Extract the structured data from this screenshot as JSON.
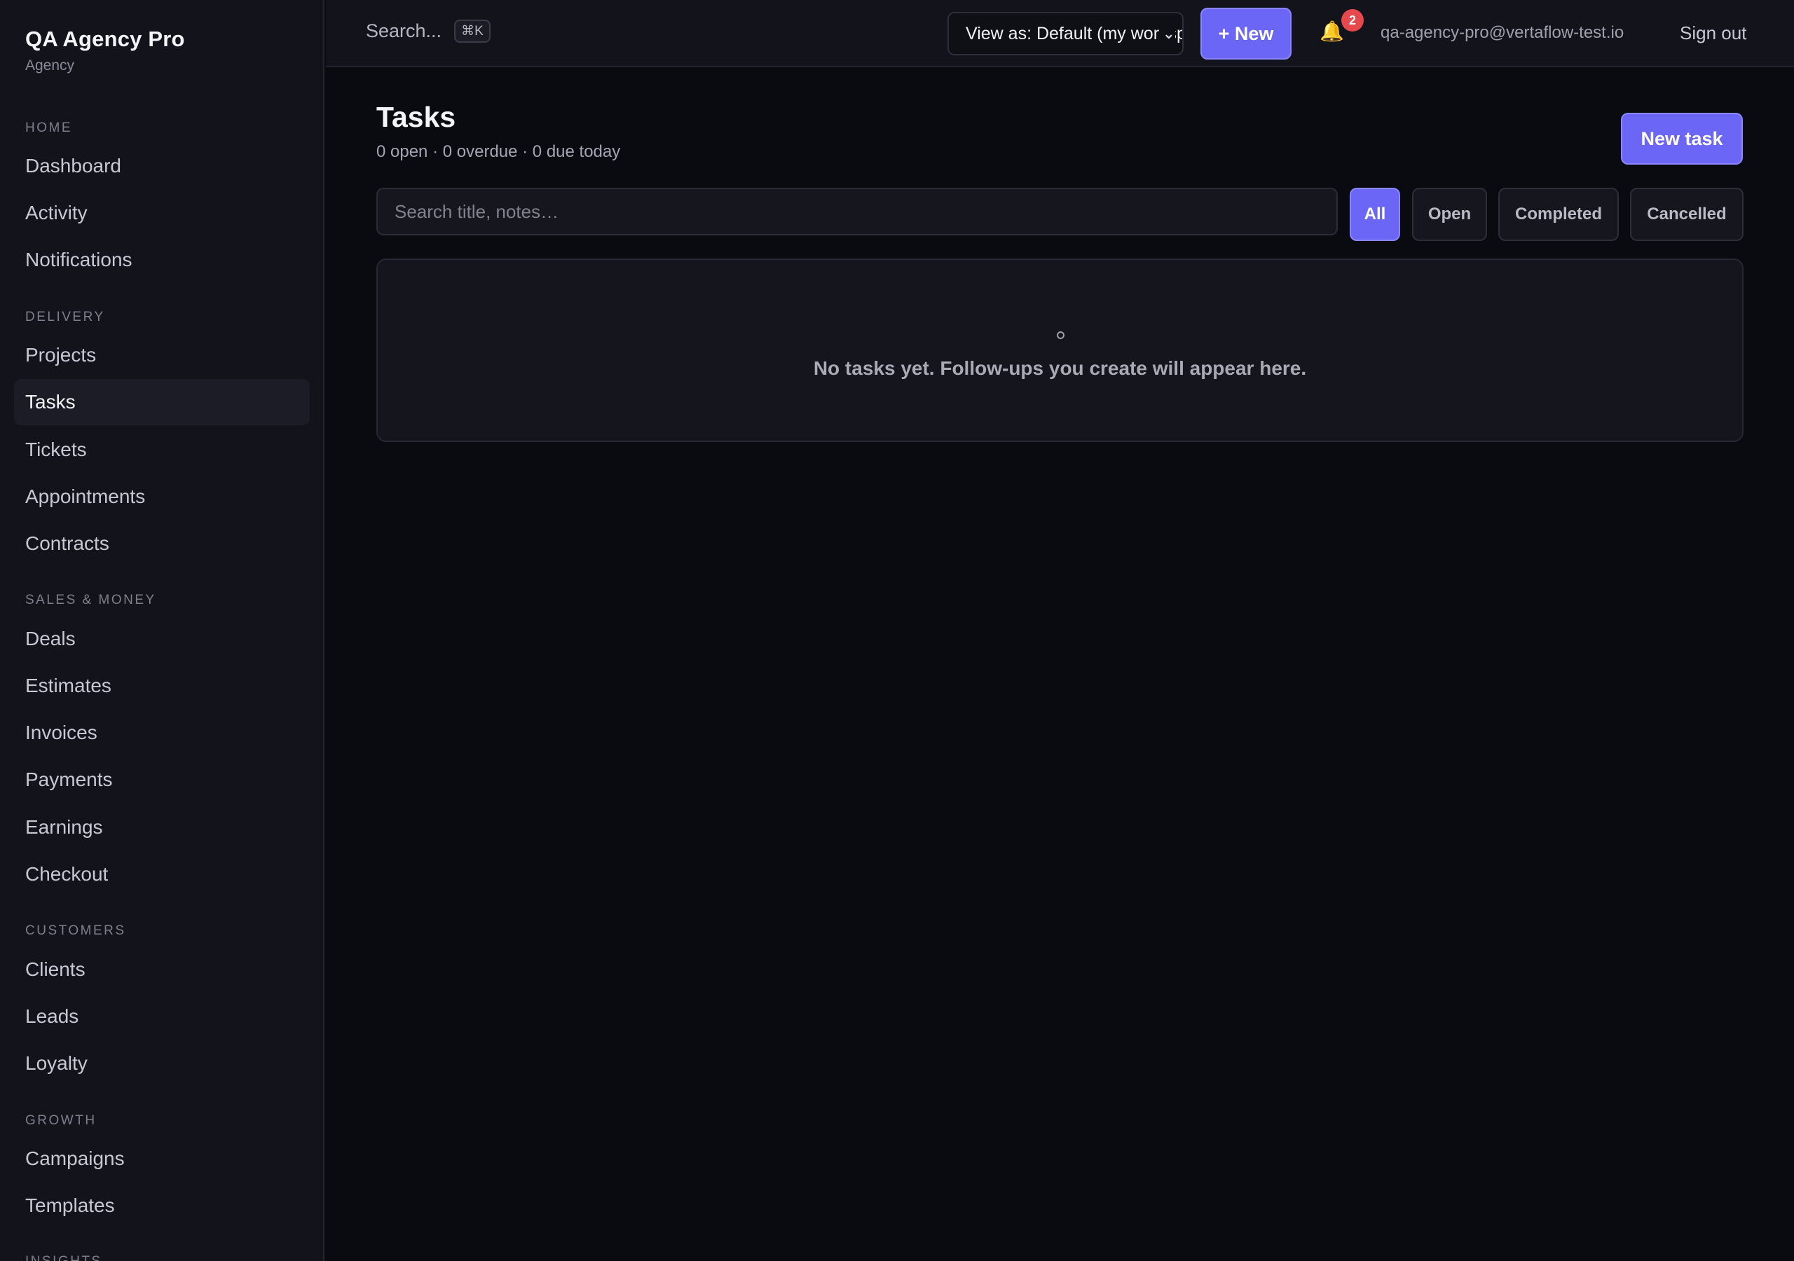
{
  "brand": {
    "name": "QA Agency Pro",
    "subtitle": "Agency"
  },
  "sidebar": {
    "sections": [
      {
        "label": "HOME",
        "items": [
          {
            "label": "Dashboard"
          },
          {
            "label": "Activity"
          },
          {
            "label": "Notifications"
          }
        ]
      },
      {
        "label": "DELIVERY",
        "items": [
          {
            "label": "Projects"
          },
          {
            "label": "Tasks",
            "active": true
          },
          {
            "label": "Tickets"
          },
          {
            "label": "Appointments"
          },
          {
            "label": "Contracts"
          }
        ]
      },
      {
        "label": "SALES & MONEY",
        "items": [
          {
            "label": "Deals"
          },
          {
            "label": "Estimates"
          },
          {
            "label": "Invoices"
          },
          {
            "label": "Payments"
          },
          {
            "label": "Earnings"
          },
          {
            "label": "Checkout"
          }
        ]
      },
      {
        "label": "CUSTOMERS",
        "items": [
          {
            "label": "Clients"
          },
          {
            "label": "Leads"
          },
          {
            "label": "Loyalty"
          }
        ]
      },
      {
        "label": "GROWTH",
        "items": [
          {
            "label": "Campaigns"
          },
          {
            "label": "Templates"
          }
        ]
      },
      {
        "label": "INSIGHTS",
        "items": []
      }
    ]
  },
  "topbar": {
    "search_label": "Search...",
    "search_shortcut": "⌘K",
    "view_as": "View as: Default (my workspace)",
    "new_label": "+ New",
    "notification_count": "2",
    "user_email": "qa-agency-pro@vertaflow-test.io",
    "signout_label": "Sign out",
    "icons": {
      "notifications": "bell-icon",
      "view_as_caret": "chevron-down-icon"
    }
  },
  "page": {
    "title": "Tasks",
    "stats": "0 open · 0 overdue · 0 due today",
    "new_task_label": "New task",
    "search_placeholder": "Search title, notes…",
    "filters": [
      {
        "label": "All",
        "active": true
      },
      {
        "label": "Open"
      },
      {
        "label": "Completed"
      },
      {
        "label": "Cancelled"
      }
    ],
    "empty_state": "No tasks yet. Follow-ups you create will appear here."
  },
  "colors": {
    "accent": "#6b66f6",
    "badge": "#e5484d",
    "background": "#0a0b10",
    "sidebar": "#13141b"
  }
}
